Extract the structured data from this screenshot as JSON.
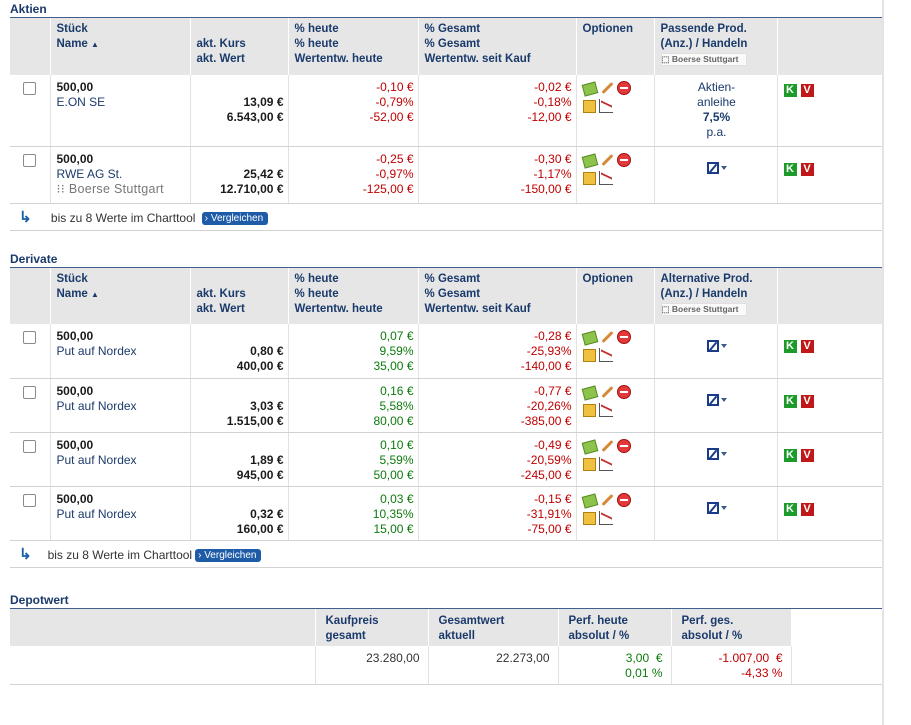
{
  "aktien": {
    "title": "Aktien",
    "headers": {
      "stueck": "Stück",
      "name": "Name",
      "kurs": "akt. Kurs",
      "wert": "akt. Wert",
      "heute_h": "heute",
      "heute_pct": "% heute",
      "heute_wertentw": "Wertentw. heute",
      "gesamt_h": "Gesamt",
      "gesamt_pct": "% Gesamt",
      "gesamt_wertentw": "Wertentw. seit Kauf",
      "optionen": "Optionen",
      "prod1": "Passende Prod.",
      "prod2": "(Anz.) / Handeln",
      "boerse": "Boerse Stuttgart"
    },
    "rows": [
      {
        "stueck": "500,00",
        "name": "E.ON SE",
        "kurs": "13,09 €",
        "wert": "6.543,00 €",
        "heute_abs": "-0,10 €",
        "heute_pct": "-0,79%",
        "heute_wert": "-52,00 €",
        "ges_abs": "-0,02 €",
        "ges_pct": "-0,18%",
        "ges_wert": "-12,00 €",
        "prod_line1": "Aktien-",
        "prod_line2": "anleihe",
        "prod_line3": "7,5%",
        "prod_line4": "p.a."
      },
      {
        "stueck": "500,00",
        "name": "RWE AG St.",
        "boerse": "Boerse Stuttgart",
        "kurs": "25,42 €",
        "wert": "12.710,00 €",
        "heute_abs": "-0,25 €",
        "heute_pct": "-0,97%",
        "heute_wert": "-125,00 €",
        "ges_abs": "-0,30 €",
        "ges_pct": "-1,17%",
        "ges_wert": "-150,00 €"
      }
    ],
    "footer": {
      "text": "bis zu 8 Werte im Charttool",
      "button": "Vergleichen"
    }
  },
  "derivate": {
    "title": "Derivate",
    "headers": {
      "stueck": "Stück",
      "name": "Name",
      "kurs": "akt. Kurs",
      "wert": "akt. Wert",
      "heute_h": "heute",
      "heute_pct": "% heute",
      "heute_wertentw": "Wertentw. heute",
      "gesamt_h": "Gesamt",
      "gesamt_pct": "% Gesamt",
      "gesamt_wertentw": "Wertentw. seit Kauf",
      "optionen": "Optionen",
      "prod1": "Alternative Prod.",
      "prod2": "(Anz.) / Handeln",
      "boerse": "Boerse Stuttgart"
    },
    "rows": [
      {
        "stueck": "500,00",
        "name": "Put auf Nordex",
        "kurs": "0,80 €",
        "wert": "400,00 €",
        "heute_abs": "0,07 €",
        "heute_pct": "9,59%",
        "heute_wert": "35,00 €",
        "ges_abs": "-0,28 €",
        "ges_pct": "-25,93%",
        "ges_wert": "-140,00 €"
      },
      {
        "stueck": "500,00",
        "name": "Put auf Nordex",
        "kurs": "3,03 €",
        "wert": "1.515,00 €",
        "heute_abs": "0,16 €",
        "heute_pct": "5,58%",
        "heute_wert": "80,00 €",
        "ges_abs": "-0,77 €",
        "ges_pct": "-20,26%",
        "ges_wert": "-385,00 €"
      },
      {
        "stueck": "500,00",
        "name": "Put auf Nordex",
        "kurs": "1,89 €",
        "wert": "945,00 €",
        "heute_abs": "0,10 €",
        "heute_pct": "5,59%",
        "heute_wert": "50,00 €",
        "ges_abs": "-0,49 €",
        "ges_pct": "-20,59%",
        "ges_wert": "-245,00 €"
      },
      {
        "stueck": "500,00",
        "name": "Put auf Nordex",
        "kurs": "0,32 €",
        "wert": "160,00 €",
        "heute_abs": "0,03 €",
        "heute_pct": "10,35%",
        "heute_wert": "15,00 €",
        "ges_abs": "-0,15 €",
        "ges_pct": "-31,91%",
        "ges_wert": "-75,00 €"
      }
    ],
    "footer": {
      "text": "bis zu 8 Werte im Charttool",
      "button": "Vergleichen"
    }
  },
  "depotwert": {
    "title": "Depotwert",
    "headers": {
      "kaufpreis1": "Kaufpreis",
      "kaufpreis2": "gesamt",
      "gesamtwert1": "Gesamtwert",
      "gesamtwert2": "aktuell",
      "perf_heute1": "Perf. heute",
      "perf_heute2": "absolut / %",
      "perf_ges1": "Perf. ges.",
      "perf_ges2": "absolut / %"
    },
    "values": {
      "kaufpreis": "23.280,00",
      "gesamtwert": "22.273,00",
      "perf_heute_abs": "3,00  €",
      "perf_heute_pct": "0,01 %",
      "perf_ges_abs": "-1.007,00  €",
      "perf_ges_pct": "-4,33 %"
    }
  },
  "colors": {
    "header_bg": "#e6e6e6",
    "title": "#1a3a6b",
    "negative": "#c00000",
    "positive": "#0c7a0c"
  }
}
